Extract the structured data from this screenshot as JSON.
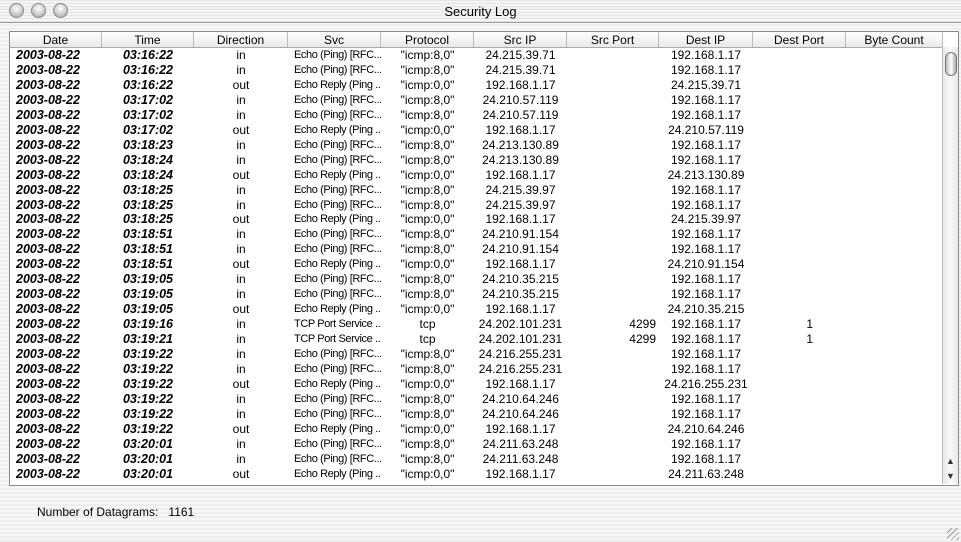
{
  "window": {
    "title": "Security Log"
  },
  "columns": [
    "Date",
    "Time",
    "Direction",
    "Svc",
    "Protocol",
    "Src IP",
    "Src Port",
    "Dest IP",
    "Dest Port",
    "Byte Count"
  ],
  "rows": [
    [
      "2003-08-22",
      "03:16:22",
      "in",
      "Echo (Ping) [RFC...",
      "\"icmp:8,0\"",
      "24.215.39.71",
      "",
      "192.168.1.17",
      "",
      ""
    ],
    [
      "2003-08-22",
      "03:16:22",
      "in",
      "Echo (Ping) [RFC...",
      "\"icmp:8,0\"",
      "24.215.39.71",
      "",
      "192.168.1.17",
      "",
      ""
    ],
    [
      "2003-08-22",
      "03:16:22",
      "out",
      "Echo Reply (Ping ...",
      "\"icmp:0,0\"",
      "192.168.1.17",
      "",
      "24.215.39.71",
      "",
      ""
    ],
    [
      "2003-08-22",
      "03:17:02",
      "in",
      "Echo (Ping) [RFC...",
      "\"icmp:8,0\"",
      "24.210.57.119",
      "",
      "192.168.1.17",
      "",
      ""
    ],
    [
      "2003-08-22",
      "03:17:02",
      "in",
      "Echo (Ping) [RFC...",
      "\"icmp:8,0\"",
      "24.210.57.119",
      "",
      "192.168.1.17",
      "",
      ""
    ],
    [
      "2003-08-22",
      "03:17:02",
      "out",
      "Echo Reply (Ping ...",
      "\"icmp:0,0\"",
      "192.168.1.17",
      "",
      "24.210.57.119",
      "",
      ""
    ],
    [
      "2003-08-22",
      "03:18:23",
      "in",
      "Echo (Ping) [RFC...",
      "\"icmp:8,0\"",
      "24.213.130.89",
      "",
      "192.168.1.17",
      "",
      ""
    ],
    [
      "2003-08-22",
      "03:18:24",
      "in",
      "Echo (Ping) [RFC...",
      "\"icmp:8,0\"",
      "24.213.130.89",
      "",
      "192.168.1.17",
      "",
      ""
    ],
    [
      "2003-08-22",
      "03:18:24",
      "out",
      "Echo Reply (Ping ...",
      "\"icmp:0,0\"",
      "192.168.1.17",
      "",
      "24.213.130.89",
      "",
      ""
    ],
    [
      "2003-08-22",
      "03:18:25",
      "in",
      "Echo (Ping) [RFC...",
      "\"icmp:8,0\"",
      "24.215.39.97",
      "",
      "192.168.1.17",
      "",
      ""
    ],
    [
      "2003-08-22",
      "03:18:25",
      "in",
      "Echo (Ping) [RFC...",
      "\"icmp:8,0\"",
      "24.215.39.97",
      "",
      "192.168.1.17",
      "",
      ""
    ],
    [
      "2003-08-22",
      "03:18:25",
      "out",
      "Echo Reply (Ping ...",
      "\"icmp:0,0\"",
      "192.168.1.17",
      "",
      "24.215.39.97",
      "",
      ""
    ],
    [
      "2003-08-22",
      "03:18:51",
      "in",
      "Echo (Ping) [RFC...",
      "\"icmp:8,0\"",
      "24.210.91.154",
      "",
      "192.168.1.17",
      "",
      ""
    ],
    [
      "2003-08-22",
      "03:18:51",
      "in",
      "Echo (Ping) [RFC...",
      "\"icmp:8,0\"",
      "24.210.91.154",
      "",
      "192.168.1.17",
      "",
      ""
    ],
    [
      "2003-08-22",
      "03:18:51",
      "out",
      "Echo Reply (Ping ...",
      "\"icmp:0,0\"",
      "192.168.1.17",
      "",
      "24.210.91.154",
      "",
      ""
    ],
    [
      "2003-08-22",
      "03:19:05",
      "in",
      "Echo (Ping) [RFC...",
      "\"icmp:8,0\"",
      "24.210.35.215",
      "",
      "192.168.1.17",
      "",
      ""
    ],
    [
      "2003-08-22",
      "03:19:05",
      "in",
      "Echo (Ping) [RFC...",
      "\"icmp:8,0\"",
      "24.210.35.215",
      "",
      "192.168.1.17",
      "",
      ""
    ],
    [
      "2003-08-22",
      "03:19:05",
      "out",
      "Echo Reply (Ping ...",
      "\"icmp:0,0\"",
      "192.168.1.17",
      "",
      "24.210.35.215",
      "",
      ""
    ],
    [
      "2003-08-22",
      "03:19:16",
      "in",
      "TCP Port Service ...",
      "tcp",
      "24.202.101.231",
      "4299",
      "192.168.1.17",
      "1",
      ""
    ],
    [
      "2003-08-22",
      "03:19:21",
      "in",
      "TCP Port Service ...",
      "tcp",
      "24.202.101.231",
      "4299",
      "192.168.1.17",
      "1",
      ""
    ],
    [
      "2003-08-22",
      "03:19:22",
      "in",
      "Echo (Ping) [RFC...",
      "\"icmp:8,0\"",
      "24.216.255.231",
      "",
      "192.168.1.17",
      "",
      ""
    ],
    [
      "2003-08-22",
      "03:19:22",
      "in",
      "Echo (Ping) [RFC...",
      "\"icmp:8,0\"",
      "24.216.255.231",
      "",
      "192.168.1.17",
      "",
      ""
    ],
    [
      "2003-08-22",
      "03:19:22",
      "out",
      "Echo Reply (Ping ...",
      "\"icmp:0,0\"",
      "192.168.1.17",
      "",
      "24.216.255.231",
      "",
      ""
    ],
    [
      "2003-08-22",
      "03:19:22",
      "in",
      "Echo (Ping) [RFC...",
      "\"icmp:8,0\"",
      "24.210.64.246",
      "",
      "192.168.1.17",
      "",
      ""
    ],
    [
      "2003-08-22",
      "03:19:22",
      "in",
      "Echo (Ping) [RFC...",
      "\"icmp:8,0\"",
      "24.210.64.246",
      "",
      "192.168.1.17",
      "",
      ""
    ],
    [
      "2003-08-22",
      "03:19:22",
      "out",
      "Echo Reply (Ping ...",
      "\"icmp:0,0\"",
      "192.168.1.17",
      "",
      "24.210.64.246",
      "",
      ""
    ],
    [
      "2003-08-22",
      "03:20:01",
      "in",
      "Echo (Ping) [RFC...",
      "\"icmp:8,0\"",
      "24.211.63.248",
      "",
      "192.168.1.17",
      "",
      ""
    ],
    [
      "2003-08-22",
      "03:20:01",
      "in",
      "Echo (Ping) [RFC...",
      "\"icmp:8,0\"",
      "24.211.63.248",
      "",
      "192.168.1.17",
      "",
      ""
    ],
    [
      "2003-08-22",
      "03:20:01",
      "out",
      "Echo Reply (Ping ...",
      "\"icmp:0,0\"",
      "192.168.1.17",
      "",
      "24.211.63.248",
      "",
      ""
    ]
  ],
  "footer": {
    "label": "Number of Datagrams:",
    "count": "1161"
  }
}
